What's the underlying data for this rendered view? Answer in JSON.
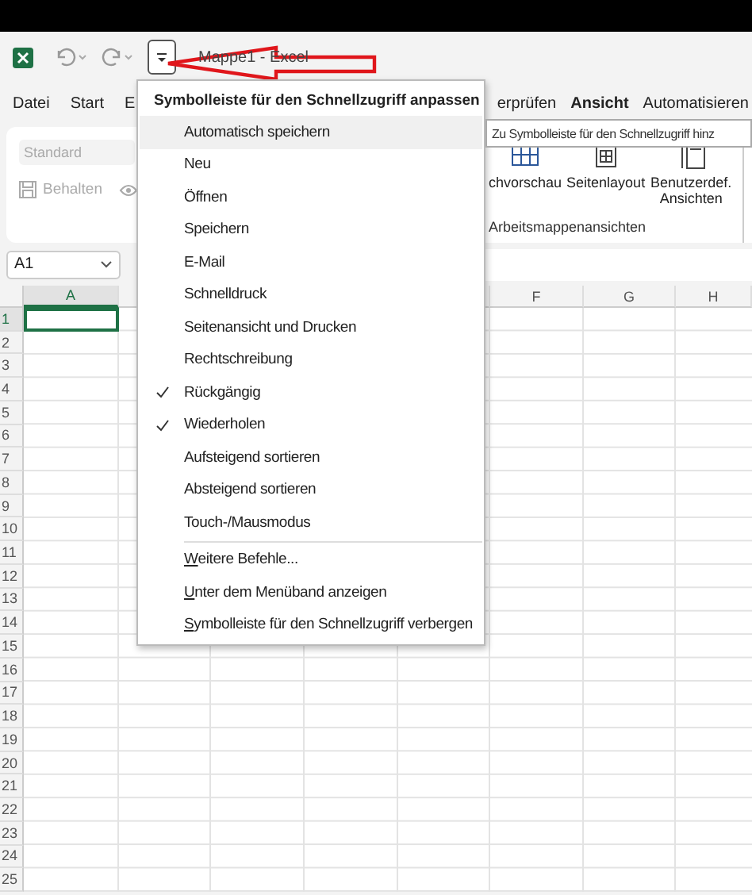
{
  "title_bar": {
    "title": "Mappe1 - Excel"
  },
  "ribbon_tabs": [
    {
      "label": "Datei",
      "selected": false
    },
    {
      "label": "Start",
      "selected": false
    },
    {
      "label": "E",
      "selected": false
    },
    {
      "label": "erprüfen",
      "selected": false
    },
    {
      "label": "Ansicht",
      "selected": true
    },
    {
      "label": "Automatisieren",
      "selected": false
    }
  ],
  "ribbon": {
    "style_dropdown": {
      "value": "Standard",
      "disabled": true
    },
    "keep_button": {
      "label": "Behalten",
      "disabled": true
    },
    "views": [
      {
        "label": "chvorschau"
      },
      {
        "label": "Seitenlayout"
      },
      {
        "label": "Benutzerdef. Ansichten"
      }
    ],
    "group_label": "Arbeitsmappenansichten"
  },
  "tooltip": "Zu Symbolleiste für den Schnellzugriff hinz",
  "name_box": "A1",
  "sheet": {
    "columns": [
      {
        "label": "A",
        "selected": true
      },
      {
        "label": "F",
        "selected": false
      },
      {
        "label": "G",
        "selected": false
      },
      {
        "label": "H",
        "selected": false
      }
    ],
    "rows": [
      {
        "label": "1",
        "selected": true
      },
      {
        "label": "2",
        "selected": false
      },
      {
        "label": "3",
        "selected": false
      },
      {
        "label": "4",
        "selected": false
      },
      {
        "label": "5",
        "selected": false
      },
      {
        "label": "6",
        "selected": false
      },
      {
        "label": "7",
        "selected": false
      },
      {
        "label": "8",
        "selected": false
      },
      {
        "label": "9",
        "selected": false
      },
      {
        "label": "10",
        "selected": false
      },
      {
        "label": "11",
        "selected": false
      },
      {
        "label": "12",
        "selected": false
      },
      {
        "label": "13",
        "selected": false
      },
      {
        "label": "14",
        "selected": false
      },
      {
        "label": "15",
        "selected": false
      },
      {
        "label": "16",
        "selected": false
      },
      {
        "label": "17",
        "selected": false
      },
      {
        "label": "18",
        "selected": false
      },
      {
        "label": "19",
        "selected": false
      },
      {
        "label": "20",
        "selected": false
      },
      {
        "label": "21",
        "selected": false
      },
      {
        "label": "22",
        "selected": false
      },
      {
        "label": "23",
        "selected": false
      },
      {
        "label": "24",
        "selected": false
      },
      {
        "label": "25",
        "selected": false
      }
    ]
  },
  "menu": {
    "title": "Symbolleiste für den Schnellzugriff anpassen",
    "items": [
      {
        "kind": "item",
        "label": "Automatisch speichern",
        "checked": false,
        "hovered": true
      },
      {
        "kind": "item",
        "label": "Neu",
        "checked": false,
        "hovered": false
      },
      {
        "kind": "item",
        "label": "Öffnen",
        "checked": false,
        "hovered": false
      },
      {
        "kind": "item",
        "label": "Speichern",
        "checked": false,
        "hovered": false
      },
      {
        "kind": "item",
        "label": "E-Mail",
        "checked": false,
        "hovered": false
      },
      {
        "kind": "item",
        "label": "Schnelldruck",
        "checked": false,
        "hovered": false
      },
      {
        "kind": "item",
        "label": "Seitenansicht und Drucken",
        "checked": false,
        "hovered": false
      },
      {
        "kind": "item",
        "label": "Rechtschreibung",
        "checked": false,
        "hovered": false
      },
      {
        "kind": "item",
        "label": "Rückgängig",
        "checked": true,
        "hovered": false
      },
      {
        "kind": "item",
        "label": "Wiederholen",
        "checked": true,
        "hovered": false
      },
      {
        "kind": "item",
        "label": "Aufsteigend sortieren",
        "checked": false,
        "hovered": false
      },
      {
        "kind": "item",
        "label": "Absteigend sortieren",
        "checked": false,
        "hovered": false
      },
      {
        "kind": "item",
        "label": "Touch-/Mausmodus",
        "checked": false,
        "hovered": false
      },
      {
        "kind": "separator"
      },
      {
        "kind": "command",
        "label": "Weitere Befehle...",
        "underline_first": true
      },
      {
        "kind": "command",
        "label": "Unter dem Menüband anzeigen",
        "underline_first": true
      },
      {
        "kind": "command",
        "label": "Symbolleiste für den Schnellzugriff verbergen",
        "underline_first": true
      }
    ]
  }
}
